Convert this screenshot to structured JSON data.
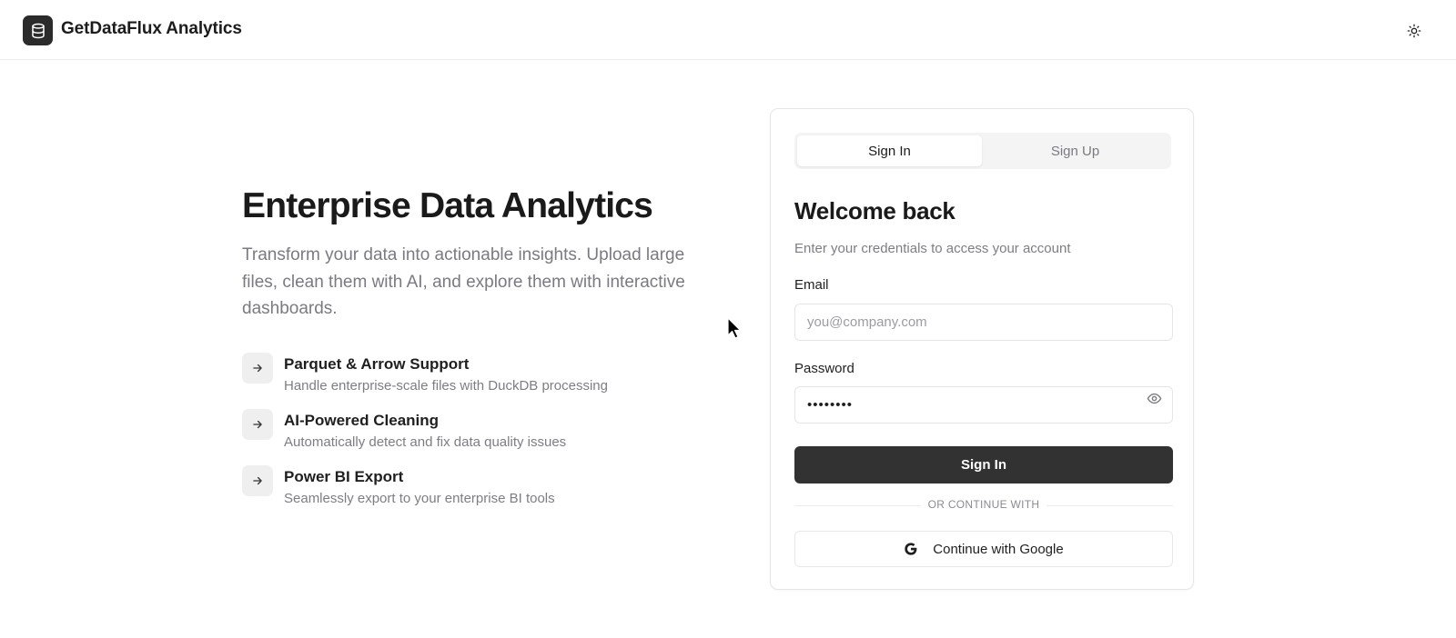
{
  "header": {
    "app_title": "GetDataFlux Analytics",
    "logo_icon": "database-icon",
    "theme_toggle_icon": "sun-icon"
  },
  "hero": {
    "title": "Enterprise Data Analytics",
    "subtitle": "Transform your data into actionable insights. Upload large files, clean them with AI, and explore them with interactive dashboards.",
    "features": [
      {
        "icon": "arrow-right-icon",
        "title": "Parquet & Arrow Support",
        "description": "Handle enterprise-scale files with DuckDB processing"
      },
      {
        "icon": "arrow-right-icon",
        "title": "AI-Powered Cleaning",
        "description": "Automatically detect and fix data quality issues"
      },
      {
        "icon": "arrow-right-icon",
        "title": "Power BI Export",
        "description": "Seamlessly export to your enterprise BI tools"
      }
    ]
  },
  "auth": {
    "tabs": [
      {
        "label": "Sign In",
        "active": true
      },
      {
        "label": "Sign Up",
        "active": false
      }
    ],
    "heading": "Welcome back",
    "subheading": "Enter your credentials to access your account",
    "email": {
      "label": "Email",
      "placeholder": "you@company.com",
      "value": ""
    },
    "password": {
      "label": "Password",
      "value": "••••••••",
      "toggle_icon": "eye-icon"
    },
    "submit_label": "Sign In",
    "divider_text": "OR CONTINUE WITH",
    "google": {
      "label": "Continue with Google",
      "icon": "google-icon"
    }
  },
  "colors": {
    "primary_button": "#333233",
    "muted_text": "#7d7d84",
    "tab_background": "#f4f4f5"
  }
}
